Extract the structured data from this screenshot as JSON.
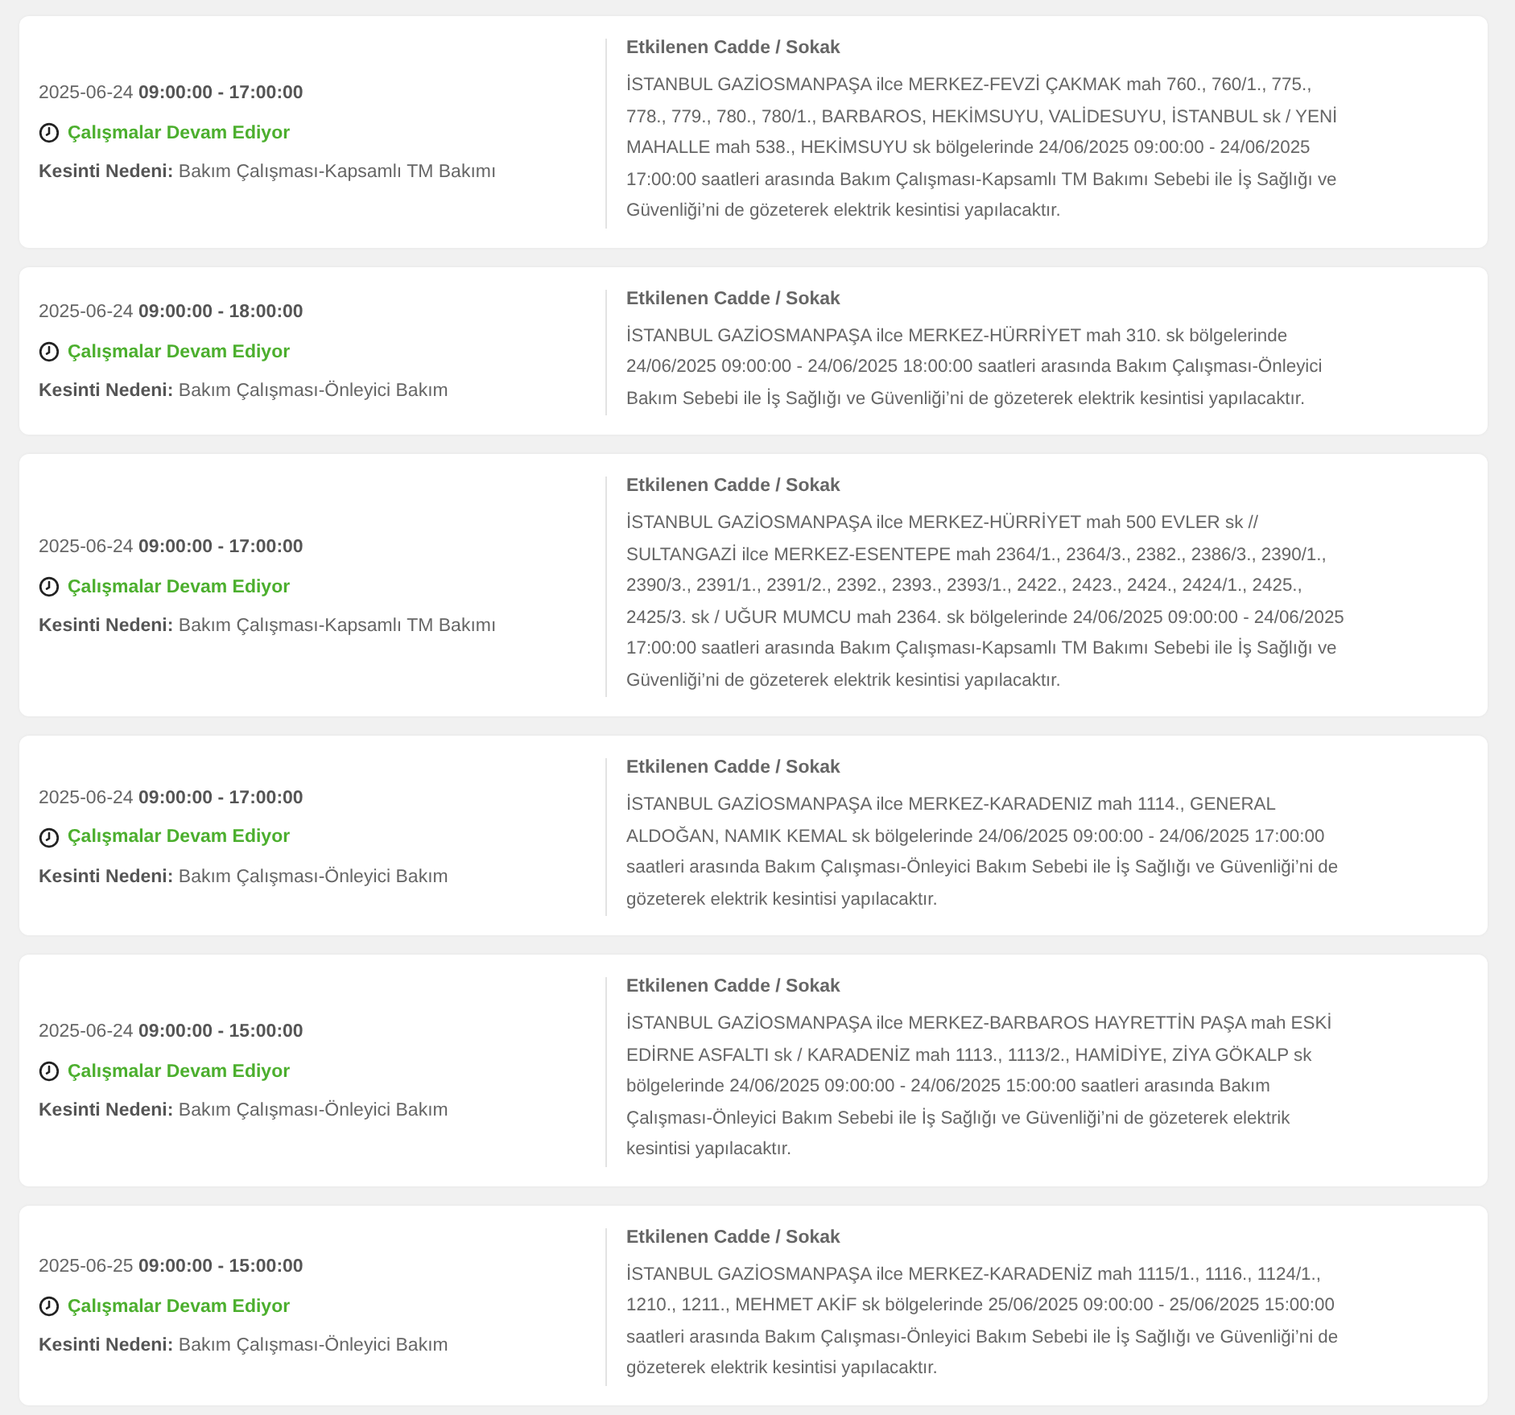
{
  "outages": [
    {
      "time": "2025-06-24 **09:00:00 - 17:00:00**",
      "status": "Çalışmalar Devam Ediyor",
      "reason": "**Kesinti Nedeni:** Bakım Çalışması-Kapsamlı TM Bakımı",
      "heading": "Etkilenen Cadde / Sokak",
      "description": "İSTANBUL GAZİOSMANPAŞA ilce MERKEZ-FEVZİ ÇAKMAK mah 760., 760/1., 775., 778., 779., 780., 780/1., BARBAROS, HEKİMSUYU, VALİDESUYU, İSTANBUL sk / YENİ MAHALLE mah 538., HEKİMSUYU sk bölgelerinde 24/06/2025 09:00:00 - 24/06/2025 17:00:00 saatleri arasında Bakım Çalışması-Kapsamlı TM Bakımı Sebebi ile İş Sağlığı ve Güvenliği’ni de gözeterek elektrik kesintisi yapılacaktır."
    },
    {
      "time": "2025-06-24 **09:00:00 - 18:00:00**",
      "status": "Çalışmalar Devam Ediyor",
      "reason": "**Kesinti Nedeni:** Bakım Çalışması-Önleyici Bakım",
      "heading": "Etkilenen Cadde / Sokak",
      "description": "İSTANBUL GAZİOSMANPAŞA ilce MERKEZ-HÜRRİYET mah 310. sk bölgelerinde 24/06/2025 09:00:00 - 24/06/2025 18:00:00 saatleri arasında Bakım Çalışması-Önleyici Bakım Sebebi ile İş Sağlığı ve Güvenliği’ni de gözeterek elektrik kesintisi yapılacaktır."
    },
    {
      "time": "2025-06-24 **09:00:00 - 17:00:00**",
      "status": "Çalışmalar Devam Ediyor",
      "reason": "**Kesinti Nedeni:** Bakım Çalışması-Kapsamlı TM Bakımı",
      "heading": "Etkilenen Cadde / Sokak",
      "description": "İSTANBUL GAZİOSMANPAŞA ilce MERKEZ-HÜRRİYET mah 500 EVLER sk // SULTANGAZİ ilce MERKEZ-ESENTEPE mah 2364/1., 2364/3., 2382., 2386/3., 2390/1., 2390/3., 2391/1., 2391/2., 2392., 2393., 2393/1., 2422., 2423., 2424., 2424/1., 2425., 2425/3. sk / UĞUR MUMCU mah 2364. sk bölgelerinde 24/06/2025 09:00:00 - 24/06/2025 17:00:00 saatleri arasında Bakım Çalışması-Kapsamlı TM Bakımı Sebebi ile İş Sağlığı ve Güvenliği’ni de gözeterek elektrik kesintisi yapılacaktır."
    },
    {
      "time": "2025-06-24 **09:00:00 - 17:00:00**",
      "status": "Çalışmalar Devam Ediyor",
      "reason": "**Kesinti Nedeni:** Bakım Çalışması-Önleyici Bakım",
      "heading": "Etkilenen Cadde / Sokak",
      "description": "İSTANBUL GAZİOSMANPAŞA ilce MERKEZ-KARADENIZ mah 1114., GENERAL ALDOĞAN, NAMIK KEMAL sk bölgelerinde 24/06/2025 09:00:00 - 24/06/2025 17:00:00 saatleri arasında Bakım Çalışması-Önleyici Bakım Sebebi ile İş Sağlığı ve Güvenliği’ni de gözeterek elektrik kesintisi yapılacaktır."
    },
    {
      "time": "2025-06-24 **09:00:00 - 15:00:00**",
      "status": "Çalışmalar Devam Ediyor",
      "reason": "**Kesinti Nedeni:** Bakım Çalışması-Önleyici Bakım",
      "heading": "Etkilenen Cadde / Sokak",
      "description": "İSTANBUL GAZİOSMANPAŞA ilce MERKEZ-BARBAROS HAYRETTİN PAŞA mah ESKİ EDİRNE ASFALTI sk / KARADENİZ mah 1113., 1113/2., HAMİDİYE, ZİYA GÖKALP sk bölgelerinde 24/06/2025 09:00:00 - 24/06/2025 15:00:00 saatleri arasında Bakım Çalışması-Önleyici Bakım Sebebi ile İş Sağlığı ve Güvenliği’ni de gözeterek elektrik kesintisi yapılacaktır."
    },
    {
      "time": "2025-06-25 **09:00:00 - 15:00:00**",
      "status": "Çalışmalar Devam Ediyor",
      "reason": "**Kesinti Nedeni:** Bakım Çalışması-Önleyici Bakım",
      "heading": "Etkilenen Cadde / Sokak",
      "description": "İSTANBUL GAZİOSMANPAŞA ilce MERKEZ-KARADENİZ mah 1115/1., 1116., 1124/1., 1210., 1211., MEHMET AKİF sk bölgelerinde 25/06/2025 09:00:00 - 25/06/2025 15:00:00 saatleri arasında Bakım Çalışması-Önleyici Bakım Sebebi ile İş Sağlığı ve Güvenliği’ni de gözeterek elektrik kesintisi yapılacaktır."
    }
  ]
}
